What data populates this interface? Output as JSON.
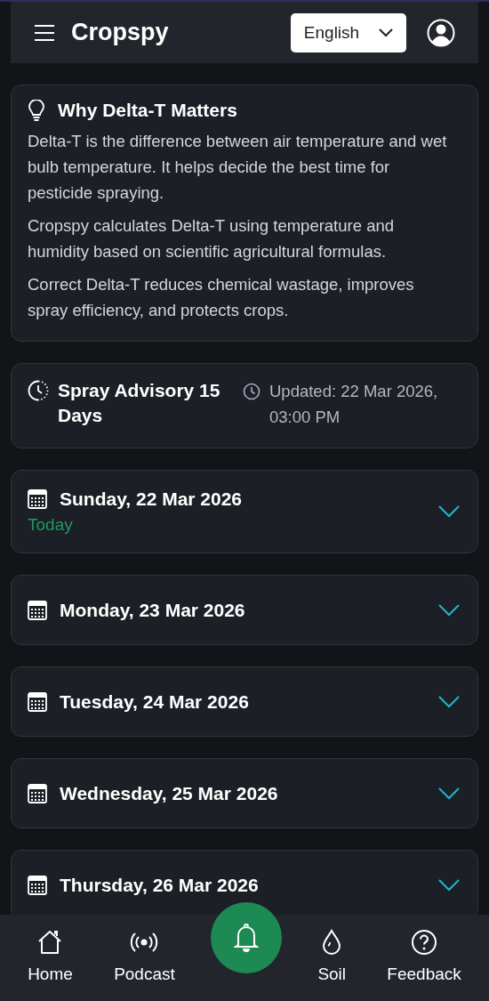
{
  "header": {
    "title": "Cropspy",
    "language": "English"
  },
  "info_card": {
    "title": "Why Delta-T Matters",
    "paragraphs": [
      "Delta-T is the difference between air temperature and wet bulb temperature. It helps decide the best time for pesticide spraying.",
      "Cropspy calculates Delta-T using temperature and humidity based on scientific agricultural formulas.",
      "Correct Delta-T reduces chemical wastage, improves spray efficiency, and protects crops."
    ]
  },
  "advisory": {
    "title": "Spray Advisory 15 Days",
    "updated": "Updated: 22 Mar 2026, 03:00 PM"
  },
  "days": [
    {
      "date": "Sunday, 22 Mar 2026",
      "subtitle": "Today",
      "expanded": false
    },
    {
      "date": "Monday, 23 Mar 2026",
      "expanded": false
    },
    {
      "date": "Tuesday, 24 Mar 2026",
      "expanded": false
    },
    {
      "date": "Wednesday, 25 Mar 2026",
      "expanded": false
    },
    {
      "date": "Thursday, 26 Mar 2026",
      "expanded": false
    }
  ],
  "bottom_nav": [
    {
      "kind": "home",
      "label": "Home"
    },
    {
      "kind": "podcast",
      "label": "Podcast"
    },
    {
      "kind": "alerts"
    },
    {
      "kind": "soil",
      "label": "Soil"
    },
    {
      "kind": "feedback",
      "label": "Feedback"
    }
  ]
}
